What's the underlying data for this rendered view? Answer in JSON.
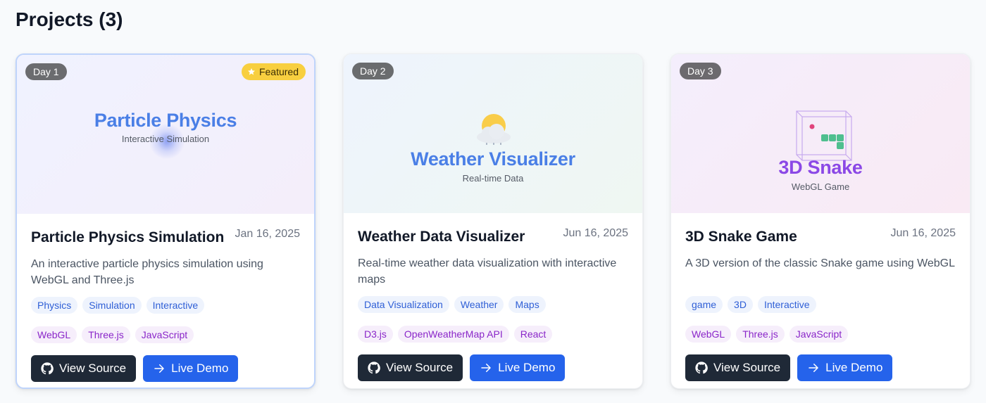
{
  "page": {
    "title": "Projects (3)"
  },
  "projects": [
    {
      "day": "Day 1",
      "featured": "Featured",
      "thumb_title": "Particle Physics",
      "thumb_subtitle": "Interactive Simulation",
      "title": "Particle Physics Simulation",
      "date": "Jan 16, 2025",
      "description": "An interactive particle physics simulation using WebGL and Three.js",
      "tags": [
        "Physics",
        "Simulation",
        "Interactive"
      ],
      "tech": [
        "WebGL",
        "Three.js",
        "JavaScript"
      ],
      "source_label": "View Source",
      "demo_label": "Live Demo"
    },
    {
      "day": "Day 2",
      "thumb_title": "Weather Visualizer",
      "thumb_subtitle": "Real-time Data",
      "title": "Weather Data Visualizer",
      "date": "Jun 16, 2025",
      "description": "Real-time weather data visualization with interactive maps",
      "tags": [
        "Data Visualization",
        "Weather",
        "Maps"
      ],
      "tech": [
        "D3.js",
        "OpenWeatherMap API",
        "React"
      ],
      "source_label": "View Source",
      "demo_label": "Live Demo"
    },
    {
      "day": "Day 3",
      "thumb_title": "3D Snake",
      "thumb_subtitle": "WebGL Game",
      "title": "3D Snake Game",
      "date": "Jun 16, 2025",
      "description": "A 3D version of the classic Snake game using WebGL",
      "tags": [
        "game",
        "3D",
        "Interactive"
      ],
      "tech": [
        "WebGL",
        "Three.js",
        "JavaScript"
      ],
      "source_label": "View Source",
      "demo_label": "Live Demo"
    }
  ],
  "colors": {
    "accent": "#2563eb",
    "dark_button": "#1f2937",
    "thumb_title_blue": "#4a7fe6",
    "thumb_title_purple": "#8b48e6",
    "featured_badge": "#f8cf3f"
  },
  "icons": [
    "star-icon",
    "github-icon",
    "arrow-right-icon",
    "sun-cloud-icon",
    "snake-cube-icon"
  ]
}
